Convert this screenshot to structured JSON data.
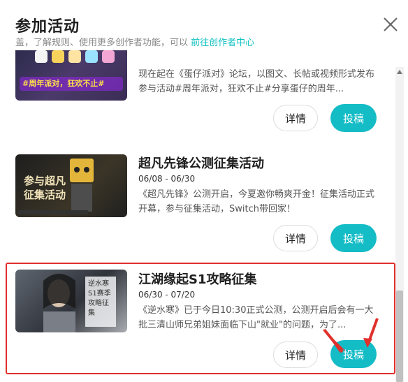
{
  "dialog": {
    "title": "参加活动",
    "subline_prefix": "盖，了解规则、使用更多创作者功能，可以",
    "subline_link": "前往创作者中心"
  },
  "items": [
    {
      "title": "",
      "date": "",
      "desc": "现在起在《蛋仔派对》论坛，以图文、长帖或视频形式发布参与活动#周年派对，狂欢不止#分享蛋仔的周年...",
      "detail_label": "详情",
      "submit_label": "投稿",
      "thumb_text": "#周年派对，狂欢不止#"
    },
    {
      "title": "超凡先锋公测征集活动",
      "date": "06/08 - 06/30",
      "desc": "《超凡先锋》公测开启，今夏邀你畅爽开金！征集活动正式开幕，参与征集活动，Switch带回家！",
      "detail_label": "详情",
      "submit_label": "投稿",
      "thumb_text": "参与超凡征集活动"
    },
    {
      "title": "江湖缘起S1攻略征集",
      "date": "06/30 - 07/20",
      "desc": "《逆水寒》已于今日10:30正式公测，公测开启后会有一大批三清山师兄弟姐妹面临下山\"就业\"的问题，为了...",
      "detail_label": "详情",
      "submit_label": "投稿",
      "thumb_text": "逆水寒 S1赛季攻略征集"
    }
  ],
  "colors": {
    "accent": "#14bcc6",
    "link": "#13c2c2",
    "highlight": "#e0302c"
  }
}
